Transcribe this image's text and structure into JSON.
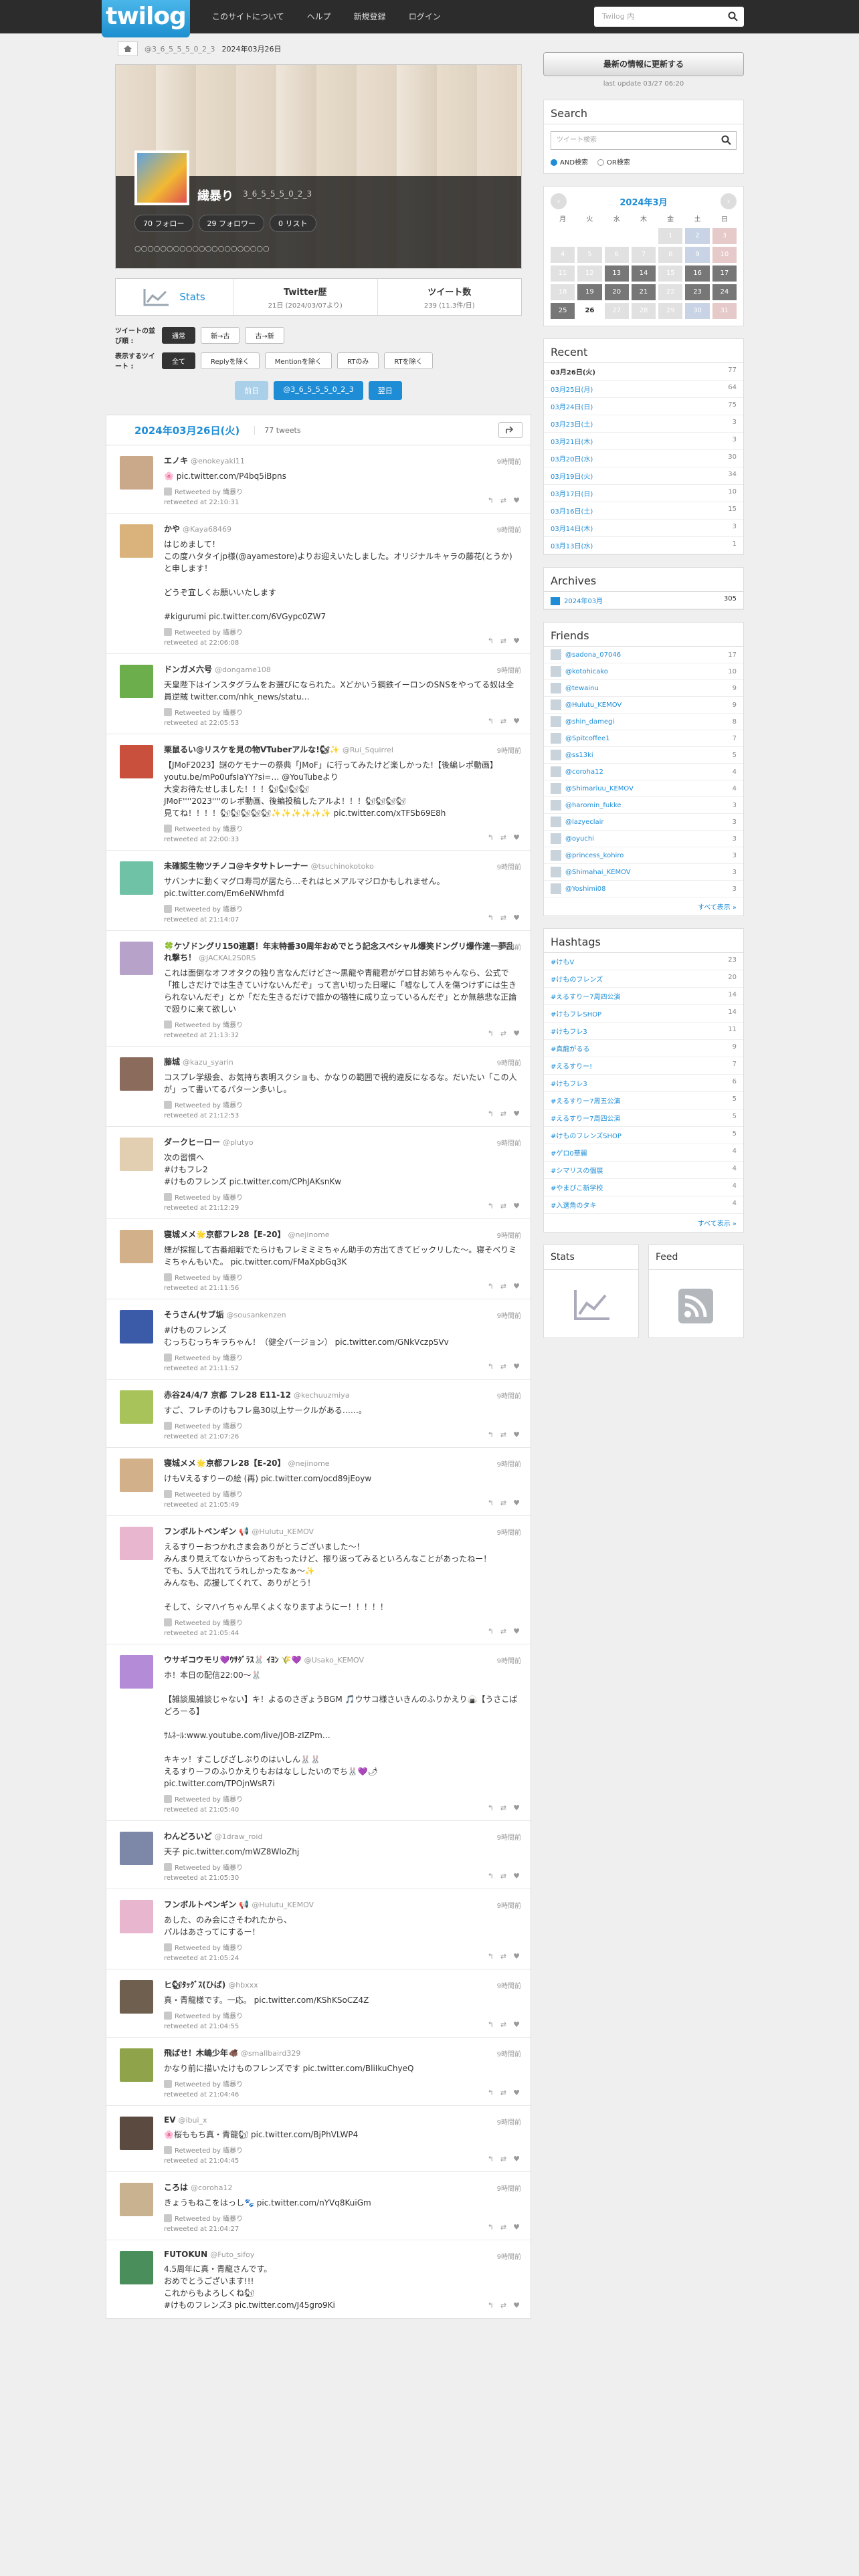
{
  "header": {
    "logo": "twilog",
    "nav": [
      "このサイトについて",
      "ヘルプ",
      "新規登録",
      "ログイン"
    ],
    "search_placeholder": "Twilog 内"
  },
  "breadcrumb": {
    "user": "@3_6_5_5_5_0_2_3",
    "date": "2024年03月26日"
  },
  "profile": {
    "name": "繊暴り",
    "handle": "3_6_5_5_5_0_2_3",
    "stats": [
      "70 フォロー",
      "29 フォロワー",
      "0 リスト"
    ],
    "bio": "○○○○○○○○○○○○○○○○○○○○○"
  },
  "statbox": {
    "stats": "Stats",
    "start_title": "Twitter歴",
    "start_val": "21日 (2024/03/07より)",
    "count_title": "ツイート数",
    "count_val": "239 (11.3件/日)"
  },
  "filters": {
    "order_label": "ツイートの並び順 :",
    "order": [
      "通常",
      "新→古",
      "古→新"
    ],
    "show_label": "表示するツイート :",
    "show": [
      "全て",
      "Replyを除く",
      "Mentionを除く",
      "RTのみ",
      "RTを除く"
    ]
  },
  "pager": {
    "prev": "前日",
    "user": "@3_6_5_5_5_0_2_3",
    "next": "翌日"
  },
  "day": {
    "date": "2024年03月26日(火)",
    "count": "77 tweets"
  },
  "tweets": [
    {
      "name": "エノキ",
      "handle": "@enokeyaki11",
      "ago": "9時間前",
      "body": "🌸 pic.twitter.com/P4bq5iBpns",
      "rt": "Retweeted by 繊暴り",
      "ts": "retweeted at 22:10:31",
      "color": "#caa98a"
    },
    {
      "name": "かや",
      "handle": "@Kaya68469",
      "ago": "9時間前",
      "body": "はじめまして！\nこの度ハタタイjp様(@ayamestore)よりお迎えいたしました。オリジナルキャラの藤花(とうか)と申します！\n\nどうぞ宜しくお願いいたします\n\n#kigurumi pic.twitter.com/6VGypc0ZW7",
      "rt": "Retweeted by 繊暴り",
      "ts": "retweeted at 22:06:08",
      "color": "#d9b27c"
    },
    {
      "name": "ドンガメ六号",
      "handle": "@dongame108",
      "ago": "9時間前",
      "body": "天皇陛下はインスタグラムをお選びになられた。Xどかいう鋼鉄イーロンのSNSをやってる奴は全員逆賊 twitter.com/nhk_news/statu…",
      "rt": "Retweeted by 繊暴り",
      "ts": "retweeted at 22:05:53",
      "color": "#6cae4b"
    },
    {
      "name": "栗鼠るい@リスケを見の物VTuberアルな!🐿✨",
      "handle": "@Rui_Squirrel",
      "ago": "9時間前",
      "body": "【JMoF2023】謎のケモナーの祭典「JMoF」に行ってみたけど楽しかった!【後編レポ動画】 youtu.be/mPo0ufsIaYY?si=… @YouTubeより\n大変お待たせしました！！！🐿🐿🐿🐿\nJMoF''''2023''''のレポ動画、後編投稿したアルよ！！！🐿🐿🐿🐿\n見てね！！！！🐿🐿🐿🐿🐿✨✨✨✨✨✨ pic.twitter.com/xTFSb69E8h",
      "rt": "Retweeted by 繊暴り",
      "ts": "retweeted at 22:00:33",
      "color": "#c8503c"
    },
    {
      "name": "未確認生物ツチノコ@キタサトレーナー",
      "handle": "@tsuchinokotoko",
      "ago": "9時間前",
      "body": "サバンナに動くマグロ寿司が居たら…それはヒメアルマジロかもしれません。 pic.twitter.com/Em6eNWhmfd",
      "rt": "Retweeted by 繊暴り",
      "ts": "retweeted at 21:14:07",
      "color": "#6fc2a5"
    },
    {
      "name": "🍀ケゾドングリ150連覇！年末特番30周年おめでとう記念スペシャル爆笑ドングリ爆作連ー夢乱れ撃ち！",
      "handle": "@JACKAL2S0RS",
      "ago": "9時間前",
      "body": "これは面倒なオフオタクの独り言なんだけどさ〜黒龍や青龍君がゲロ甘お姉ちゃんなら、公式で「推しさだけでは生きていけないんだぞ」って言い切った日曜に「嘘なして人を傷つけずには生きられないんだぞ」とか「だた生きるだけで誰かの犠牲に成り立っているんだぞ」とか無慈悲な正論で殴りに来て欲しい",
      "rt": "Retweeted by 繊暴り",
      "ts": "retweeted at 21:13:32",
      "color": "#b7a3c9"
    },
    {
      "name": "藤城",
      "handle": "@kazu_syarin",
      "ago": "9時間前",
      "body": "コスプレ学級会、お気持ち表明スクショも、かなりの範囲で視約違反になるな。だいたい「この人が」って書いてるパターン多いし。",
      "rt": "Retweeted by 繊暴り",
      "ts": "retweeted at 21:12:53",
      "color": "#8a6b5c"
    },
    {
      "name": "ダークヒーロー",
      "handle": "@plutyo",
      "ago": "9時間前",
      "body": "次の習慣へ\n#けもフレ2\n#けものフレンズ pic.twitter.com/CPhJAKsnKw",
      "rt": "Retweeted by 繊暴り",
      "ts": "retweeted at 21:12:29",
      "color": "#e2cfb1"
    },
    {
      "name": "寝城メメ🌟京都フレ28【E-20】",
      "handle": "@nejinome",
      "ago": "9時間前",
      "body": "煙が採掘して古番組戦でたらけもフレミミミちゃん助手の方出てきてビックリした～。寝そべりミミちゃんもいた。 pic.twitter.com/FMaXpbGq3K",
      "rt": "Retweeted by 繊暴り",
      "ts": "retweeted at 21:11:56",
      "color": "#d1b08a"
    },
    {
      "name": "そうさん(サブ垢",
      "handle": "@sousankenzen",
      "ago": "9時間前",
      "body": "#けものフレンズ\nむっちむっちキラちゃん！（健全バージョン） pic.twitter.com/GNkVczpSVv",
      "rt": "Retweeted by 繊暴り",
      "ts": "retweeted at 21:11:52",
      "color": "#3b5aa8"
    },
    {
      "name": "赤谷24/4/7 京都 フレ28 E11-12",
      "handle": "@kechuuzmiya",
      "ago": "9時間前",
      "body": "すご、フレチのけもフレ島30以上サークルがある……。",
      "rt": "Retweeted by 繊暴り",
      "ts": "retweeted at 21:07:26",
      "color": "#a7c35a"
    },
    {
      "name": "寝城メメ🌟京都フレ28【E-20】",
      "handle": "@nejinome",
      "ago": "9時間前",
      "body": "けもVえるすりーの絵 (再) pic.twitter.com/ocd89jEoyw",
      "rt": "Retweeted by 繊暴り",
      "ts": "retweeted at 21:05:49",
      "color": "#d1b08a"
    },
    {
      "name": "フンボルトペンギン 📢",
      "handle": "@Hulutu_KEMOV",
      "ago": "9時間前",
      "body": "えるすりーおつかれさま会ありがとうございました〜！\nみんまり見えてないからっておもったけど、振り返ってみるといろんなことがあったねー！\nでも、5人で出れてうれしかったなぁ〜✨\nみんなも、応援してくれて、ありがとう！\n\nそして、シマハイちゃん早くよくなりますようにー！！！！！",
      "rt": "Retweeted by 繊暴り",
      "ts": "retweeted at 21:05:44",
      "color": "#e8b6cf"
    },
    {
      "name": "ウサギコウモリ💜ｳｻｸﾞﾗｽ🐰 ｲﾖﾝ 🌾💜",
      "handle": "@Usako_KEMOV",
      "ago": "9時間前",
      "body": "ホ！本日の配信22:00〜🐰\n\n【雑談風雑談じゃない】キ！よるのさぎょうBGM 🎵ウサコ様さいきんのふりかえり🍙【うさこばどろーる】\n\nｻﾑﾈｰﾙ:www.youtube.com/live/JOB-zIZPm…\n\nキキッ！すこしびざしぶりのはいしん🐰🐰\nえるすりーフのふりかえりもおはなししたいのでち🐰💜🌶\npic.twitter.com/TPOjnWsR7i",
      "rt": "Retweeted by 繊暴り",
      "ts": "retweeted at 21:05:40",
      "color": "#b38bd6"
    },
    {
      "name": "わんどろいど",
      "handle": "@1draw_roid",
      "ago": "9時間前",
      "body": "天子 pic.twitter.com/mWZ8WloZhj",
      "rt": "Retweeted by 繊暴り",
      "ts": "retweeted at 21:05:30",
      "color": "#7d87a8"
    },
    {
      "name": "フンボルトペンギン 📢",
      "handle": "@Hulutu_KEMOV",
      "ago": "9時間前",
      "body": "あした、のみ会にさそわれたから、\nパルはあさってにするー！",
      "rt": "Retweeted by 繊暴り",
      "ts": "retweeted at 21:05:24",
      "color": "#e8b6cf"
    },
    {
      "name": "ヒ🐿ﾀｯｸﾞｽ(ひば)",
      "handle": "@hbxxx",
      "ago": "9時間前",
      "body": "真・青龍様です。一応。 pic.twitter.com/KShKSoCZ4Z",
      "rt": "Retweeted by 繊暴り",
      "ts": "retweeted at 21:04:55",
      "color": "#6f5f4f"
    },
    {
      "name": "飛ばせ！木嶋少年🐗",
      "handle": "@smallbaird329",
      "ago": "9時間前",
      "body": "かなり前に描いたけものフレンズです pic.twitter.com/BliIkuChyeQ",
      "rt": "Retweeted by 繊暴り",
      "ts": "retweeted at 21:04:46",
      "color": "#8fa34b"
    },
    {
      "name": "EV",
      "handle": "@ibui_x",
      "ago": "9時間前",
      "body": "🌸桜ももち真・青龍🐿 pic.twitter.com/BjPhVLWP4",
      "rt": "Retweeted by 繊暴り",
      "ts": "retweeted at 21:04:45",
      "color": "#5a4a3f"
    },
    {
      "name": "ころは",
      "handle": "@coroha12",
      "ago": "9時間前",
      "body": "きょうもねこをはっし🐾 pic.twitter.com/nYVq8KuiGm",
      "rt": "Retweeted by 繊暴り",
      "ts": "retweeted at 21:04:27",
      "color": "#c9b28f"
    },
    {
      "name": "FUTOKUN",
      "handle": "@Futo_sifoy",
      "ago": "9時間前",
      "body": "4.5周年に真・青龍さんです。\nおめでとうございます!!!\nこれからもよろしくね🐿\n#けものフレンズ3 pic.twitter.com/J45gro9Ki",
      "rt": "",
      "ts": "",
      "color": "#4a8e5b"
    }
  ],
  "side": {
    "update_btn": "最新の情報に更新する",
    "last_update": "last update 03/27 06:20",
    "search_title": "Search",
    "search_placeholder": "ツイート検索",
    "and_label": "AND検索",
    "or_label": "OR検索",
    "cal_title": "2024年3月",
    "weekdays": [
      "月",
      "火",
      "水",
      "木",
      "金",
      "土",
      "日"
    ],
    "days": [
      "",
      "",
      "",
      "",
      "1",
      "2",
      "3",
      "4",
      "5",
      "6",
      "7",
      "8",
      "9",
      "10",
      "11",
      "12",
      "13",
      "14",
      "15",
      "16",
      "17",
      "18",
      "19",
      "20",
      "21",
      "22",
      "23",
      "24",
      "25",
      "26",
      "27",
      "28",
      "29",
      "30",
      "31"
    ],
    "recent_title": "Recent",
    "recent": [
      [
        "03月26日(火)",
        "77"
      ],
      [
        "03月25日(月)",
        "64"
      ],
      [
        "03月24日(日)",
        "75"
      ],
      [
        "03月23日(土)",
        "3"
      ],
      [
        "03月21日(木)",
        "3"
      ],
      [
        "03月20日(水)",
        "30"
      ],
      [
        "03月19日(火)",
        "34"
      ],
      [
        "03月17日(日)",
        "10"
      ],
      [
        "03月16日(土)",
        "15"
      ],
      [
        "03月14日(木)",
        "3"
      ],
      [
        "03月13日(水)",
        "1"
      ]
    ],
    "archives_title": "Archives",
    "archives": [
      [
        "2024年03月",
        "305"
      ]
    ],
    "friends_title": "Friends",
    "friends": [
      [
        "@sadona_07046",
        "17"
      ],
      [
        "@kotohicako",
        "10"
      ],
      [
        "@tewainu",
        "9"
      ],
      [
        "@Hulutu_KEMOV",
        "9"
      ],
      [
        "@shin_damegi",
        "8"
      ],
      [
        "@Spitcoffee1",
        "7"
      ],
      [
        "@ss13ki",
        "5"
      ],
      [
        "@coroha12",
        "4"
      ],
      [
        "@Shimariuu_KEMOV",
        "4"
      ],
      [
        "@haromin_fukke",
        "3"
      ],
      [
        "@lazyeclair",
        "3"
      ],
      [
        "@oyuchi",
        "3"
      ],
      [
        "@princess_kohiro",
        "3"
      ],
      [
        "@Shimahai_KEMOV",
        "3"
      ],
      [
        "@Yoshimi08",
        "3"
      ]
    ],
    "friends_more": "すべて表示 »",
    "tags_title": "Hashtags",
    "tags": [
      [
        "#けもV",
        "23"
      ],
      [
        "#けものフレンズ",
        "20"
      ],
      [
        "#えるすりー7周四公演",
        "14"
      ],
      [
        "#けもフレSHOP",
        "14"
      ],
      [
        "#けもフレ3",
        "11"
      ],
      [
        "#真龍がるる",
        "9"
      ],
      [
        "#えるすりー!",
        "7"
      ],
      [
        "#けもフレ3",
        "6"
      ],
      [
        "#えるすりー7周五公演",
        "5"
      ],
      [
        "#えるすりー7周四公演",
        "5"
      ],
      [
        "#けものフレンズSHOP",
        "5"
      ],
      [
        "#ゲロ0華麗",
        "4"
      ],
      [
        "#シマリスの個展",
        "4"
      ],
      [
        "#やまびこ新学校",
        "4"
      ],
      [
        "#入選角のタキ",
        "4"
      ]
    ],
    "tags_more": "すべて表示 »",
    "stats_title": "Stats",
    "feed_title": "Feed"
  },
  "colors": {
    "accent": "#1f8dd6",
    "topbar": "#2c2c2c"
  }
}
